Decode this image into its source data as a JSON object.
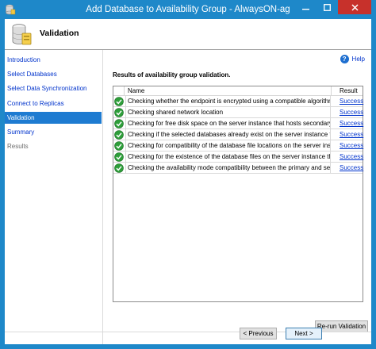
{
  "window": {
    "title": "Add Database to Availability Group - AlwaysON-ag"
  },
  "header": {
    "title": "Validation",
    "icon": "database-wizard-icon"
  },
  "sidebar": {
    "items": [
      {
        "label": "Introduction",
        "state": "link"
      },
      {
        "label": "Select Databases",
        "state": "link"
      },
      {
        "label": "Select Data Synchronization",
        "state": "link"
      },
      {
        "label": "Connect to Replicas",
        "state": "link"
      },
      {
        "label": "Validation",
        "state": "active"
      },
      {
        "label": "Summary",
        "state": "link"
      },
      {
        "label": "Results",
        "state": "disabled"
      }
    ]
  },
  "main": {
    "help_label": "Help",
    "section_title": "Results of availability group validation.",
    "grid": {
      "columns": {
        "name": "Name",
        "result": "Result"
      },
      "rows": [
        {
          "name": "Checking whether the endpoint is encrypted using a compatible algorithm",
          "result": "Success"
        },
        {
          "name": "Checking shared network location",
          "result": "Success"
        },
        {
          "name": "Checking for free disk space on the server instance that hosts secondary re...",
          "result": "Success"
        },
        {
          "name": "Checking if the selected databases already exist on the server instance that ...",
          "result": "Success"
        },
        {
          "name": "Checking for compatibility of the database file locations on the server insta...",
          "result": "Success"
        },
        {
          "name": "Checking for the existence of the database files on the server instance that ...",
          "result": "Success"
        },
        {
          "name": "Checking the availability mode compatibility between the primary and sec...",
          "result": "Success"
        }
      ]
    },
    "rerun_label": "Re-run Validation"
  },
  "footer": {
    "previous_label": "< Previous",
    "next_label": "Next >"
  },
  "colors": {
    "titlebar": "#1e88c9",
    "close": "#c7312b",
    "active_nav": "#1e7bd1",
    "link": "#0033cc",
    "success": "#2e9e3a"
  }
}
